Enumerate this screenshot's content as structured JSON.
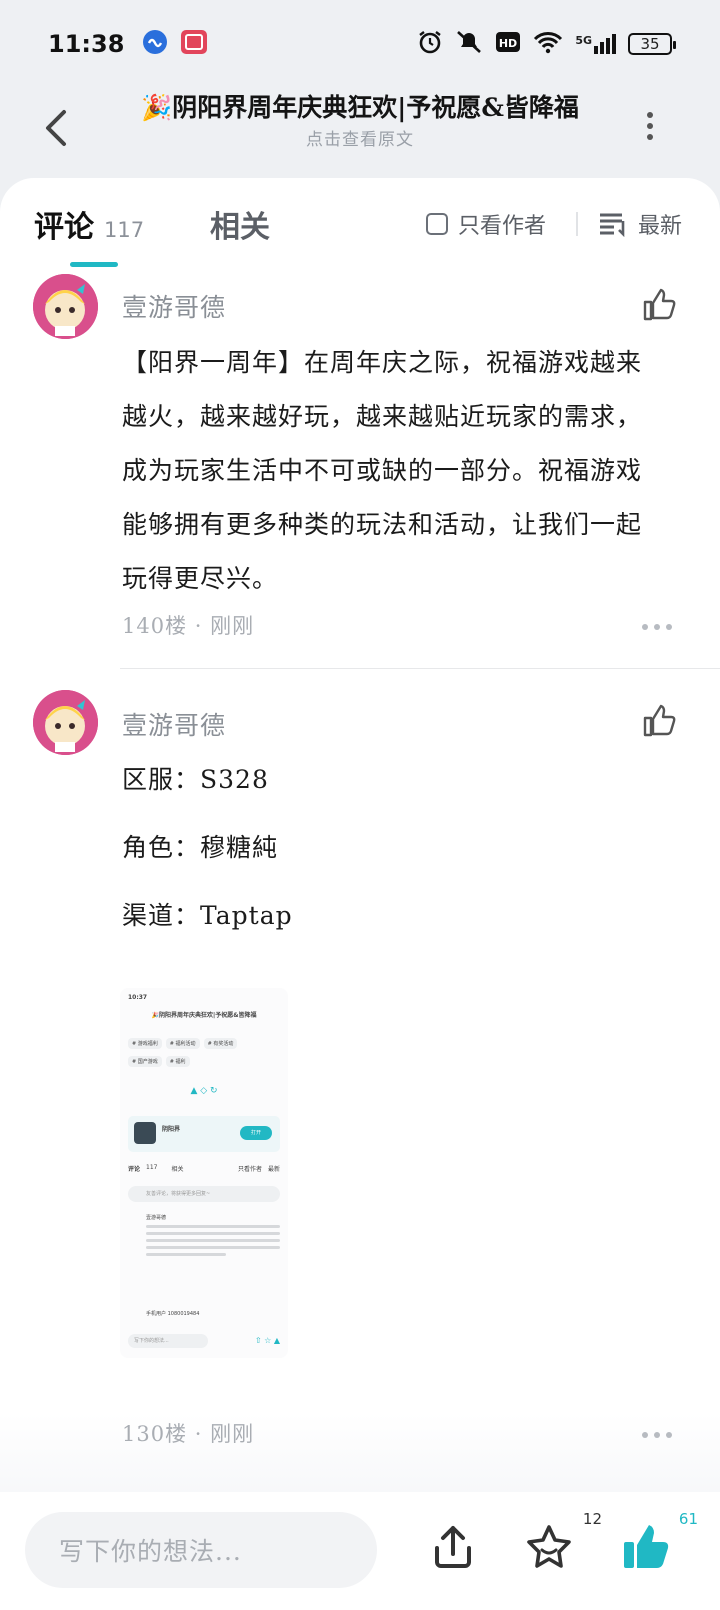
{
  "status_bar": {
    "time": "11:38",
    "battery": "35",
    "network": "5G",
    "icons": [
      "app-notification-icon",
      "app-red-icon",
      "alarm-icon",
      "mute-icon",
      "hd-icon",
      "wifi-icon",
      "signal-icon",
      "battery-icon"
    ]
  },
  "header": {
    "title": "🎉阴阳界周年庆典狂欢|予祝愿&皆降福",
    "subtitle": "点击查看原文"
  },
  "tabs": {
    "comments_label": "评论",
    "comments_count": "117",
    "related_label": "相关",
    "author_only_label": "只看作者",
    "sort_label": "最新"
  },
  "comments": [
    {
      "username": "壹游哥德",
      "body": "【阳界一周年】在周年庆之际，祝福游戏越来越火，越来越好玩，越来越贴近玩家的需求，成为玩家生活中不可或缺的一部分。祝福游戏能够拥有更多种类的玩法和活动，让我们一起玩得更尽兴。",
      "floor": "140楼",
      "time": "刚刚"
    },
    {
      "username": "壹游哥德",
      "server_line": "区服：S328",
      "role_line": "角色：穆糖純",
      "channel_line": "渠道：Taptap",
      "floor": "130楼",
      "time": "刚刚"
    }
  ],
  "thumbnail": {
    "time": "10:37",
    "title": "🎉阴阳界周年庆典狂欢|予祝愿&皆降福",
    "tags": [
      "# 游戏福利",
      "# 福利活动",
      "# 有奖活动",
      "# 国产游戏",
      "# 福利"
    ],
    "app_name": "阴阳界",
    "open_label": "打开",
    "tab_comments": "评论",
    "tab_count": "117",
    "tab_related": "相关",
    "tab_author_only": "只看作者",
    "tab_sort": "最新",
    "input_placeholder": "友善评论，将获得更多回复~",
    "user1": "壹游哥德",
    "user2": "手机用户 1080019484",
    "bottom_input": "写下你的想法..."
  },
  "bottom_bar": {
    "input_placeholder": "写下你的想法...",
    "favorite_count": "12",
    "like_count": "61"
  },
  "colors": {
    "accent": "#20b8c4",
    "avatar_bg": "#d94f8c"
  }
}
